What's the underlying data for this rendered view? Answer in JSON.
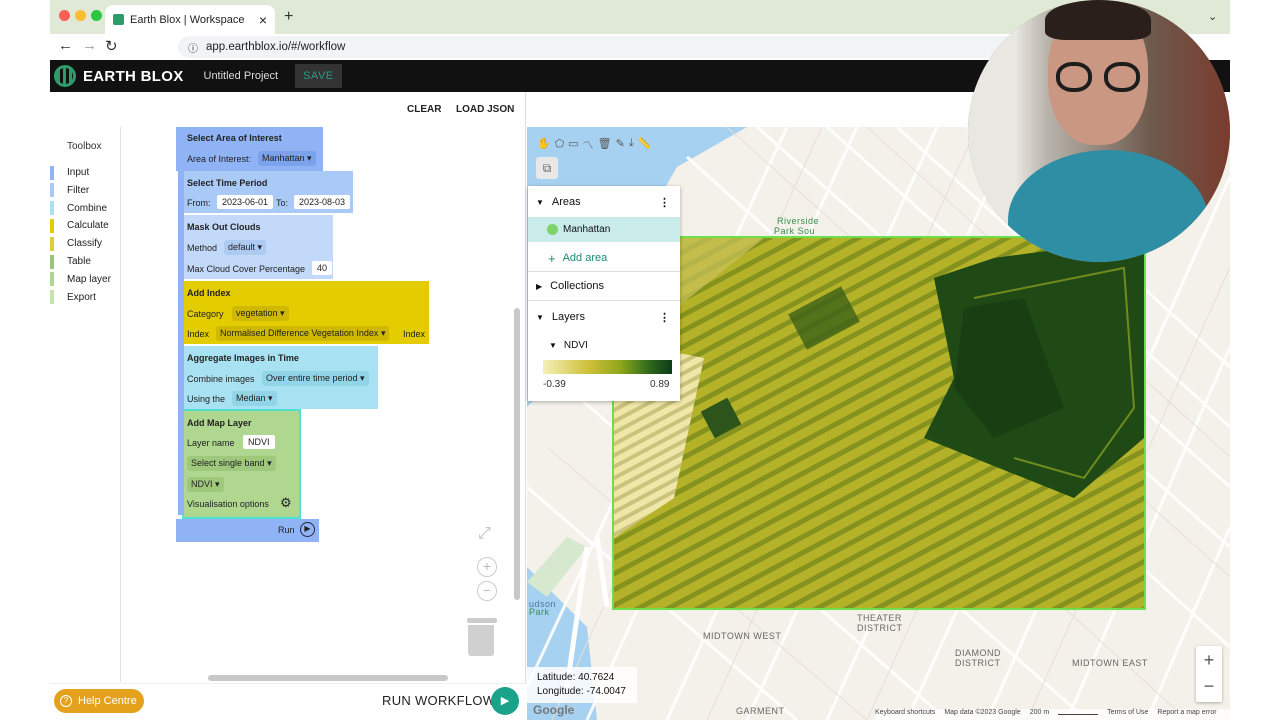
{
  "browser": {
    "tab_title": "Earth Blox | Workspace",
    "new_tab": "+",
    "url": "app.earthblox.io/#/workflow",
    "close": "×"
  },
  "app": {
    "brand": "EARTH BLOX",
    "project": "Untitled Project",
    "save": "SAVE",
    "clear": "CLEAR",
    "load_json": "LOAD JSON"
  },
  "toolbox": {
    "title": "Toolbox",
    "items": [
      {
        "label": "Input",
        "color": "#8fb3f4"
      },
      {
        "label": "Filter",
        "color": "#a9c9f7"
      },
      {
        "label": "Combine",
        "color": "#a8e2f2"
      },
      {
        "label": "Calculate",
        "color": "#e3cc00"
      },
      {
        "label": "Classify",
        "color": "#dccf3c"
      },
      {
        "label": "Table",
        "color": "#9ac47a"
      },
      {
        "label": "Map layer",
        "color": "#b0d790"
      },
      {
        "label": "Export",
        "color": "#c6e3b0"
      }
    ]
  },
  "blocks": {
    "aoi": {
      "title": "Select Area of Interest",
      "label": "Area of Interest:",
      "value": "Manhattan"
    },
    "time": {
      "title": "Select Time Period",
      "from_label": "From:",
      "from": "2023-06-01",
      "to_label": "To:",
      "to": "2023-08-03"
    },
    "clouds": {
      "title": "Mask Out Clouds",
      "method_label": "Method",
      "method": "default",
      "max_label": "Max Cloud Cover Percentage",
      "max": "40"
    },
    "index": {
      "title": "Add Index",
      "cat_label": "Category",
      "category": "vegetation",
      "idx_label": "Index",
      "index": "Normalised Difference Vegetation Index",
      "suffix": "Index"
    },
    "agg": {
      "title": "Aggregate Images in Time",
      "combine_label": "Combine images",
      "combine": "Over entire time period",
      "using_label": "Using the",
      "using": "Median"
    },
    "layer": {
      "title": "Add Map Layer",
      "name_label": "Layer name",
      "name": "NDVI",
      "band": "Select single band",
      "band_value": "NDVI",
      "vis": "Visualisation options"
    },
    "run": "Run"
  },
  "footer": {
    "help": "Help Centre",
    "run_workflow": "RUN WORKFLOW"
  },
  "map_panel": {
    "areas": "Areas",
    "area_item": "Manhattan",
    "add_area": "Add area",
    "collections": "Collections",
    "layers": "Layers",
    "layer_item": "NDVI",
    "min": "-0.39",
    "max": "0.89"
  },
  "map": {
    "lat": "Latitude: 40.7624",
    "lon": "Longitude: -74.0047",
    "labels": {
      "riverside": "Riverside",
      "park": "Park Sou",
      "theater": "THEATER",
      "district": "DISTRICT",
      "midtown_west": "MIDTOWN WEST",
      "diamond": "DIAMOND",
      "district2": "DISTRICT",
      "midtown_east": "MIDTOWN EAST",
      "garment": "GARMENT",
      "hudson": "udson",
      "hpark": "Park",
      "google": "Google"
    },
    "attrib": {
      "keys": "Keyboard shortcuts",
      "data": "Map data ©2023 Google",
      "scale": "200 m",
      "terms": "Terms of Use",
      "report": "Report a map error"
    },
    "zoom_in": "+",
    "zoom_out": "−"
  },
  "colors": {
    "accent": "#1aa38a",
    "ndvi_low": "#f5f0b8",
    "ndvi_mid": "#a3b41c",
    "ndvi_high": "#0c3b1a"
  }
}
